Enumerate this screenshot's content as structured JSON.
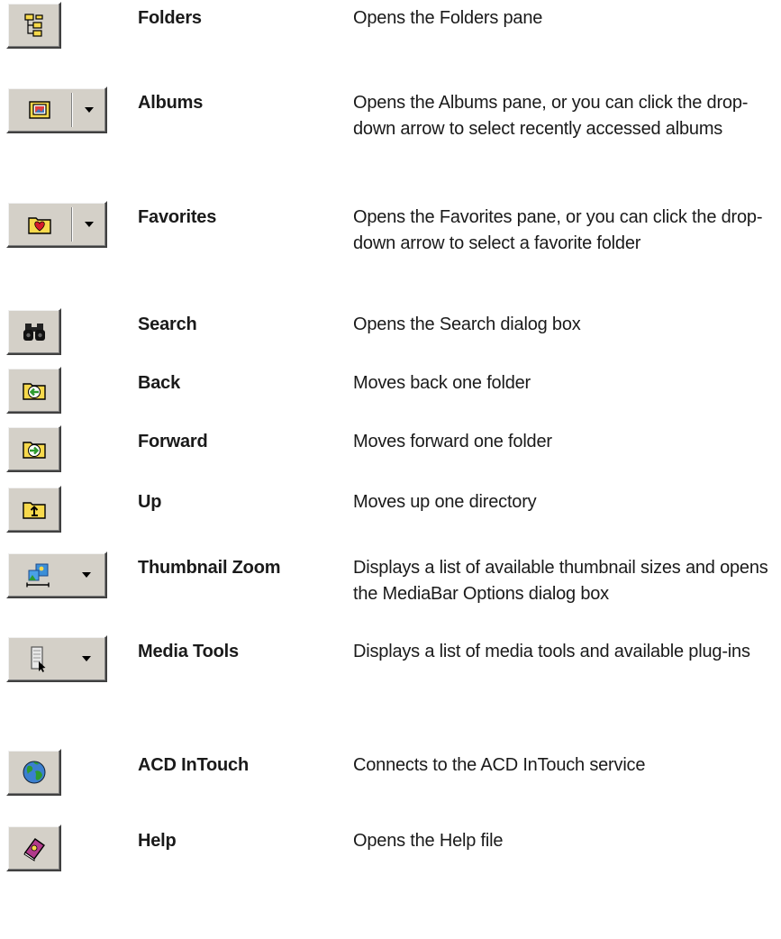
{
  "items": [
    {
      "name": "Folders",
      "description": "Opens the Folders pane",
      "icon": "folders-tree-icon"
    },
    {
      "name": "Albums",
      "description": "Opens the Albums pane, or you can click the drop-down arrow to select recently accessed albums",
      "icon": "album-icon"
    },
    {
      "name": "Favorites",
      "description": "Opens the Favorites pane, or you can click the drop-down arrow to select a favorite folder",
      "icon": "favorites-folder-heart-icon"
    },
    {
      "name": "Search",
      "description": "Opens the Search dialog box",
      "icon": "binoculars-icon"
    },
    {
      "name": "Back",
      "description": "Moves back one folder",
      "icon": "folder-back-arrow-icon"
    },
    {
      "name": "Forward",
      "description": "Moves forward one folder",
      "icon": "folder-forward-arrow-icon"
    },
    {
      "name": "Up",
      "description": "Moves up one directory",
      "icon": "folder-up-arrow-icon"
    },
    {
      "name": "Thumbnail Zoom",
      "description": "Displays a list of available thumbnail sizes and opens the MediaBar Options dialog box",
      "icon": "thumbnail-zoom-icon"
    },
    {
      "name": "Media Tools",
      "description": "Displays a list of media tools and available plug-ins",
      "icon": "media-tools-icon"
    },
    {
      "name": "ACD InTouch",
      "description": "Connects to the ACD InTouch service",
      "icon": "globe-icon"
    },
    {
      "name": "Help",
      "description": "Opens the Help file",
      "icon": "help-book-icon"
    }
  ],
  "colors": {
    "button_face": "#d4d0c8",
    "folder_yellow": "#f7d94c",
    "arrow_green": "#2e9b2e",
    "heart_red": "#d61a2a"
  }
}
